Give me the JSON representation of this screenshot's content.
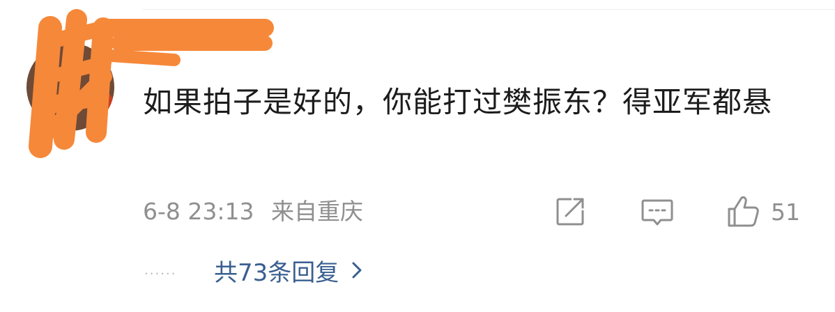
{
  "comment": {
    "text": "如果拍子是好的，你能打过樊振东？得亚军都悬",
    "date": "6-8 23:13",
    "location": "来自重庆"
  },
  "actions": {
    "share_icon": "share-icon",
    "reply_icon": "comment-icon",
    "like_icon": "thumbs-up-icon",
    "like_count": "51"
  },
  "replies": {
    "dots": "......",
    "label": "共73条回复",
    "chevron_icon": "chevron-right-icon"
  },
  "colors": {
    "text": "#1c1c1c",
    "meta": "#8f8f8f",
    "link": "#3a5f90",
    "redaction": "#f6883a"
  }
}
